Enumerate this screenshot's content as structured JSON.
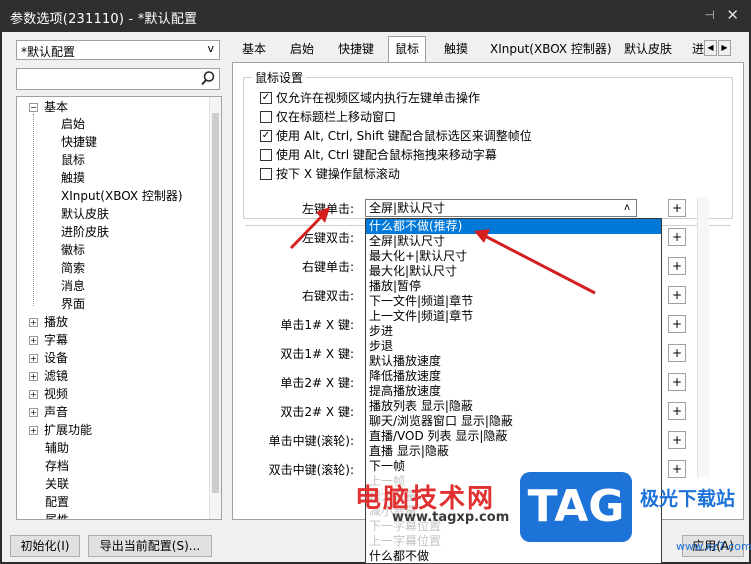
{
  "window": {
    "title": "参数选项(231110) - *默认配置",
    "pin": "⊣",
    "close": "✕"
  },
  "left": {
    "profile_select": "*默认配置",
    "profile_arrow": "v",
    "tree": {
      "root_basic": "基本",
      "basic_children": [
        "启始",
        "快捷键",
        "鼠标",
        "触摸",
        "XInput(XBOX 控制器)",
        "默认皮肤",
        "进阶皮肤",
        "徽标",
        "简索",
        "消息",
        "界面"
      ],
      "collapsed_groups": [
        "播放",
        "字幕",
        "设备",
        "滤镜",
        "视频",
        "声音",
        "扩展功能"
      ],
      "plain_items": [
        "辅助",
        "存档",
        "关联",
        "配置",
        "属性"
      ]
    }
  },
  "buttons": {
    "init": "初始化(I)",
    "export": "导出当前配置(S)...",
    "apply": "应用(A)"
  },
  "tabs": [
    "基本",
    "启始",
    "快捷键",
    "鼠标",
    "触摸",
    "XInput(XBOX 控制器)",
    "默认皮肤",
    "进"
  ],
  "tab_scroll_left": "◀",
  "tab_scroll_right": "▶",
  "mouse_settings": {
    "group_title": "鼠标设置",
    "options": [
      {
        "label": "仅允许在视频区域内执行左键单击操作",
        "checked": true
      },
      {
        "label": "仅在标题栏上移动窗口",
        "checked": false
      },
      {
        "label": "使用 Alt, Ctrl, Shift 键配合鼠标选区来调整帧位",
        "checked": true
      },
      {
        "label": "使用 Alt, Ctrl 键配合鼠标拖拽来移动字幕",
        "checked": false
      },
      {
        "label": "按下 X 键操作鼠标滚动",
        "checked": false
      }
    ],
    "check_mark": "✓"
  },
  "actions": {
    "labels": [
      "左键单击:",
      "左键双击:",
      "右键单击:",
      "右键双击:",
      "单击1# X 键:",
      "双击1# X 键:",
      "单击2# X 键:",
      "双击2# X 键:",
      "单击中键(滚轮):",
      "双击中键(滚轮):"
    ],
    "left_click_value": "全屏|默认尺寸",
    "combo_caret": "ʌ",
    "plus": "+"
  },
  "dropdown": {
    "selected": "什么都不做(推荐)",
    "items": [
      "全屏|默认尺寸",
      "最大化+|默认尺寸",
      "最大化|默认尺寸",
      "播放|暂停",
      "下一文件|频道|章节",
      "上一文件|频道|章节",
      "步进",
      "步退",
      "默认播放速度",
      "降低播放速度",
      "提高播放速度",
      "播放列表 显示|隐蔽",
      "聊天/浏览器窗口 显示|隐蔽",
      "直播/VOD 列表 显示|隐蔽",
      "直播 显示|隐蔽",
      "下一帧"
    ],
    "faded_items": [
      "上一帧",
      "增大音量",
      "减小音量",
      "下一字幕位置",
      "上一字幕位置"
    ],
    "last_item": "什么都不做"
  },
  "watermark": {
    "cn_text": "电脑技术网",
    "url": "www.tagxp.com",
    "logo": "TAG",
    "logo_cn": "极光下载站",
    "logo_url": "www.xz7.com"
  }
}
